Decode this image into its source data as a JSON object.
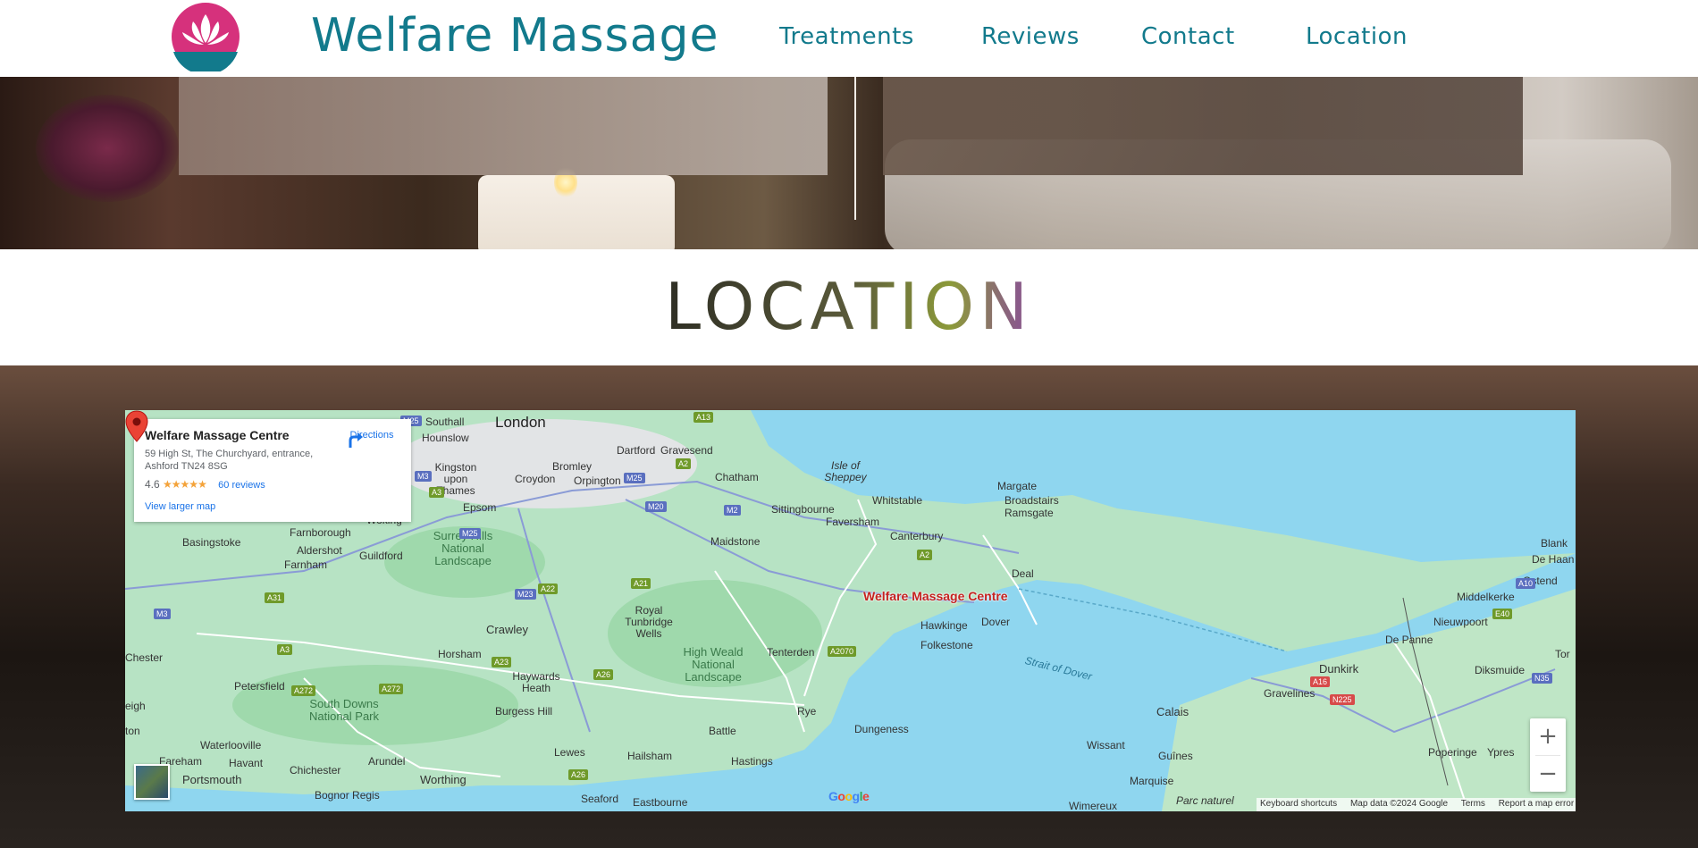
{
  "header": {
    "brand": "Welfare Massage",
    "nav": [
      "Treatments",
      "Reviews",
      "Contact",
      "Location"
    ]
  },
  "section": {
    "title": "LOCATION"
  },
  "map": {
    "place_card": {
      "name": "Welfare Massage Centre",
      "address": "59 High St, The Churchyard, entrance, Ashford TN24 8SG",
      "rating": "4.6",
      "stars": "★★★★★",
      "reviews": "60 reviews",
      "larger_map": "View larger map",
      "directions": "Directions"
    },
    "pin_label": "Welfare Massage Centre",
    "zoom_in": "+",
    "zoom_out": "−",
    "google_logo": [
      "G",
      "o",
      "o",
      "g",
      "l",
      "e"
    ],
    "attribution": [
      "Keyboard shortcuts",
      "Map data ©2024 Google",
      "Terms",
      "Report a map error"
    ],
    "places": [
      "London",
      "Southall",
      "Hounslow",
      "Kingston upon Thames",
      "Bromley",
      "Croydon",
      "Orpington",
      "Dartford",
      "Gravesend",
      "Chatham",
      "Isle of Sheppey",
      "Whitstable",
      "Margate",
      "Broadstairs",
      "Ramsgate",
      "Sittingbourne",
      "Faversham",
      "Canterbury",
      "Maidstone",
      "Epsom",
      "Woking",
      "Farnborough",
      "Basingstoke",
      "Aldershot",
      "Guildford",
      "Farnham",
      "Surrey Hills National Landscape",
      "Crawley",
      "Royal Tunbridge Wells",
      "Tenterden",
      "High Weald National Landscape",
      "Horsham",
      "Haywards Heath",
      "Burgess Hill",
      "Petersfield",
      "South Downs National Park",
      "Hawkinge",
      "Folkestone",
      "Dover",
      "Deal",
      "Rye",
      "Battle",
      "Dungeness",
      "Lewes",
      "Hailsham",
      "Hastings",
      "Waterlooville",
      "Havant",
      "Fareham",
      "Portsmouth",
      "Chichester",
      "Arundel",
      "Worthing",
      "Bognor Regis",
      "Seaford",
      "Eastbourne",
      "Strait of Dover",
      "Calais",
      "Wissant",
      "Guînes",
      "Marquise",
      "Wimereux",
      "Parc naturel",
      "Dunkirk",
      "Gravelines",
      "De Panne",
      "Nieuwpoort",
      "Middelkerke",
      "Ostend",
      "De Haan",
      "Blank",
      "Diksmuide",
      "Poperinge",
      "Ypres",
      "Chester",
      "eigh",
      "ton",
      "Tor"
    ],
    "roads": {
      "motorways": [
        "M25",
        "M3",
        "M25",
        "M2",
        "M20",
        "M25",
        "M23",
        "M3"
      ],
      "a_roads": [
        "A13",
        "A2",
        "A3",
        "A31",
        "A22",
        "A21",
        "A23",
        "A26",
        "A272",
        "A272",
        "A3",
        "A2070",
        "A2",
        "A26",
        "A2"
      ],
      "continental": [
        "A10",
        "E40",
        "A16",
        "N225",
        "N35"
      ]
    }
  }
}
